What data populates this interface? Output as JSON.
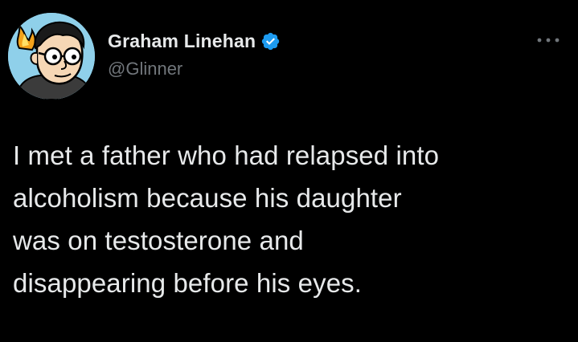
{
  "author": {
    "display_name": "Graham Linehan",
    "handle": "@Glinner",
    "verified": true,
    "avatar_icon": "cartoon-portrait-avatar"
  },
  "menu": {
    "icon": "more-options-icon"
  },
  "tweet": {
    "text": "I met a father who had relapsed into\nalcoholism because his daughter\nwas on testosterone and\ndisappearing before his eyes."
  },
  "colors": {
    "background": "#000000",
    "text_primary": "#e7e9ea",
    "text_secondary": "#71767b",
    "verified_badge": "#1d9bf0",
    "avatar_background": "#8fd0ea"
  }
}
